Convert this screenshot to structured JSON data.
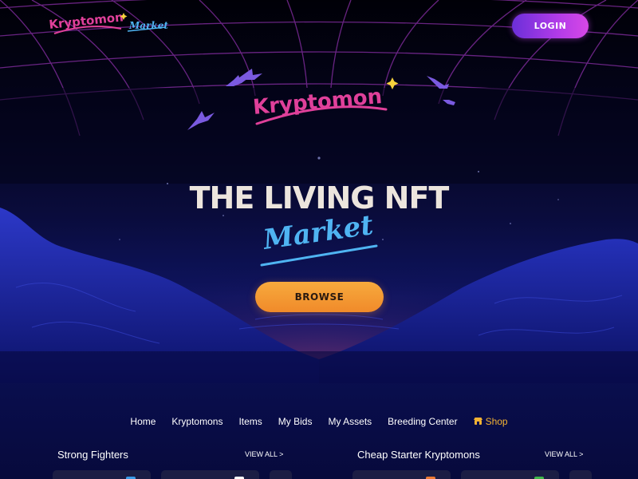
{
  "header": {
    "brand": "Kryptomon",
    "brand_sub": "Market",
    "login_label": "LOGIN"
  },
  "hero": {
    "logo_text": "Kryptomon",
    "headline": "THE LIVING NFT",
    "script_word": "Market",
    "browse_label": "BROWSE"
  },
  "nav": {
    "items": [
      "Home",
      "Kryptomons",
      "Items",
      "My Bids",
      "My Assets",
      "Breeding Center"
    ],
    "shop_label": "Shop"
  },
  "sections": [
    {
      "title": "Strong Fighters",
      "view_all": "VIEW ALL >"
    },
    {
      "title": "Cheap Starter Kryptomons",
      "view_all": "VIEW ALL >"
    }
  ],
  "colors": {
    "brand_pink": "#e0409a",
    "script_blue": "#4fb4f2",
    "accent_orange": "#f29a33",
    "login_purple": "#b23be8",
    "badge_blue": "#3a9be8",
    "badge_white": "#ffffff",
    "badge_orange": "#ee7a33",
    "badge_green": "#3fb84a"
  },
  "icons": {
    "shop": "store-icon",
    "sparkle": "sparkle-icon",
    "creature": "flying-creature-icon"
  }
}
